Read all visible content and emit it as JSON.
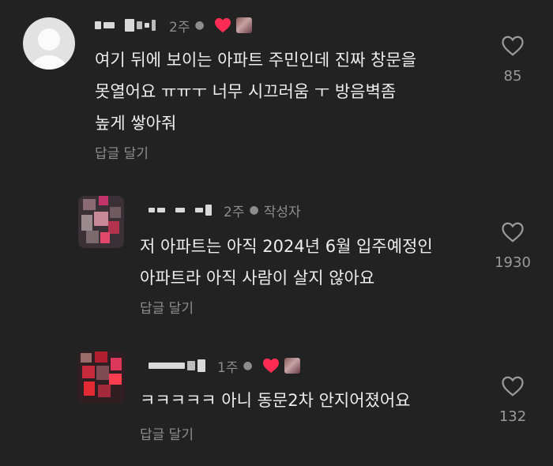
{
  "comments": [
    {
      "time": "2주",
      "text_lines": [
        "여기 뒤에 보이는 아파트 주민인데 진짜 창문을",
        "못열어요 ㅠㅠㅜ 너무 시끄러움 ㅜ 방음벽좀",
        "높게 쌓아줘"
      ],
      "reply_label": "답글 달기",
      "likes": "85",
      "liked_by_creator": true
    },
    {
      "time": "2주",
      "author_tag": "작성자",
      "text_lines": [
        "저 아파트는 아직 2024년 6월 입주예정인",
        "아파트라 아직 사람이 살지 않아요"
      ],
      "reply_label": "답글 달기",
      "likes": "1930",
      "liked_by_creator": false
    },
    {
      "time": "1주",
      "text_lines": [
        "ㅋㅋㅋㅋㅋ 아니 동문2차 안지어졌어요"
      ],
      "reply_label": "답글 달기",
      "likes": "132",
      "liked_by_creator": true
    }
  ],
  "icons": {
    "like": "heart-outline-icon",
    "creator_like": "heart-filled-icon"
  },
  "colors": {
    "background": "#222222",
    "heart_red": "#fe2c55",
    "text": "#ededed",
    "secondary_text": "#8d8d8d"
  }
}
